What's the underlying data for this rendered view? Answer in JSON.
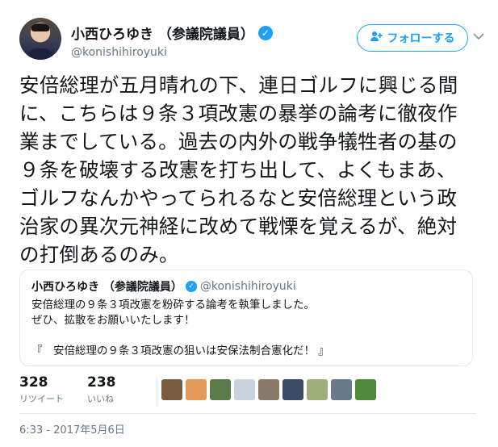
{
  "author": {
    "display_name": "小西ひろゆき （参議院議員）",
    "handle": "@konishihiroyuki",
    "verified_icon": "✓"
  },
  "follow_button": {
    "label": "フォローする",
    "icon": "follow-person-plus-icon"
  },
  "menu_caret": "⌄",
  "tweet_text": "安倍総理が五月晴れの下、連日ゴルフに興じる間に、こちらは９条３項改憲の暴挙の論考に徹夜作業までしている。過去の内外の戦争犠牲者の基の９条を破壊する改憲を打ち出して、よくもまあ、ゴルフなんかやってられるなと安倍総理という政治家の異次元神経に改めて戦慄を覚えるが、絶対の打倒あるのみ。",
  "quoted_tweet": {
    "display_name": "小西ひろゆき （参議院議員）",
    "handle": "@konishihiroyuki",
    "body": "安倍総理の９条３項改憲を粉砕する論考を執筆しました。\nぜひ、拡散をお願いいたします！\n\n『　安倍総理の９条３項改憲の狙いは安保法制合憲化だ！ 』"
  },
  "stats": {
    "retweets": {
      "count": "328",
      "label": "リツイート"
    },
    "likes": {
      "count": "238",
      "label": "いいね"
    }
  },
  "liker_avatars": [
    {
      "name": "liker-avatar-1",
      "color": "#7a5c3e"
    },
    {
      "name": "liker-avatar-2",
      "color": "#e39a5a"
    },
    {
      "name": "liker-avatar-3",
      "color": "#5d7a4a"
    },
    {
      "name": "liker-avatar-4",
      "color": "#c9d3e0"
    },
    {
      "name": "liker-avatar-5",
      "color": "#8a7a6a"
    },
    {
      "name": "liker-avatar-6",
      "color": "#3c4a66"
    },
    {
      "name": "liker-avatar-7",
      "color": "#9fae7a"
    },
    {
      "name": "liker-avatar-8",
      "color": "#6b7a88"
    },
    {
      "name": "liker-avatar-9",
      "color": "#4f8a3a"
    }
  ],
  "timestamp": "6:33 - 2017年5月6日"
}
